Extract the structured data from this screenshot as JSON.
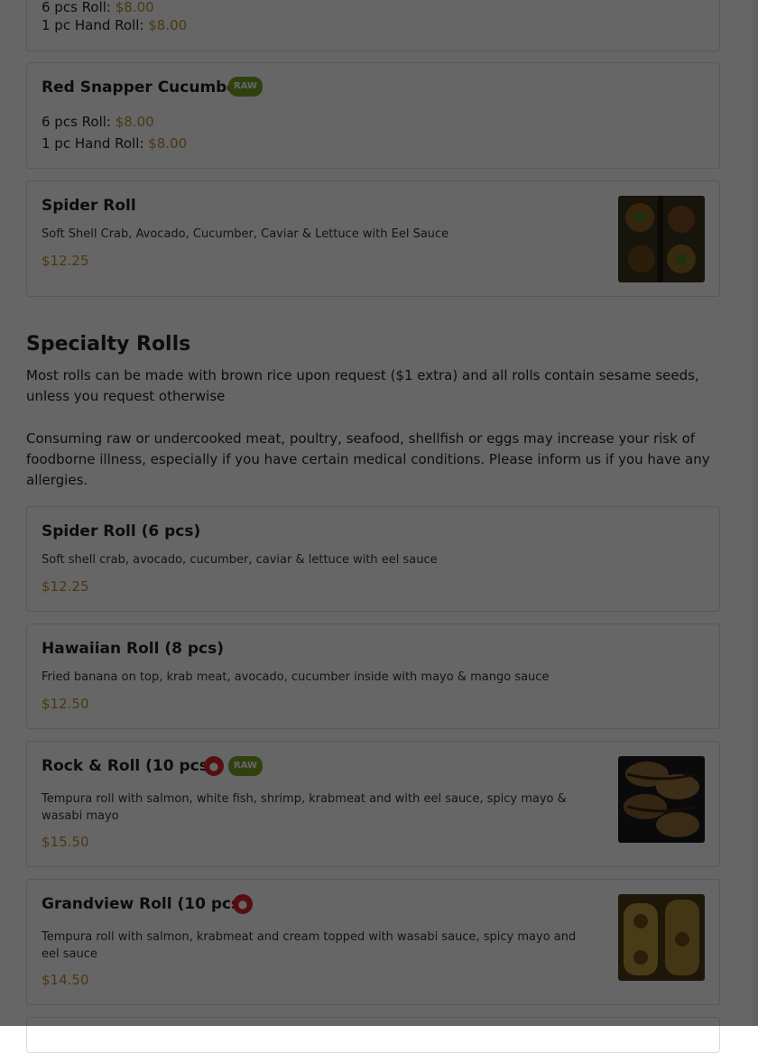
{
  "items_top": [
    {
      "name": "",
      "prices": [
        {
          "label": "6 pcs Roll:",
          "amount": "$8.00"
        },
        {
          "label": "1 pc Hand Roll:",
          "amount": "$8.00"
        }
      ]
    },
    {
      "name": "Red Snapper Cucumber",
      "badge": "RAW",
      "prices": [
        {
          "label": "6 pcs Roll:",
          "amount": "$8.00"
        },
        {
          "label": "1 pc Hand Roll:",
          "amount": "$8.00"
        }
      ]
    },
    {
      "name": "Spider Roll",
      "description": "Soft Shell Crab, Avocado, Cucumber, Caviar & Lettuce with Eel Sauce",
      "price": "$12.25",
      "image": "sushi-photo"
    }
  ],
  "section": {
    "title": "Specialty Rolls",
    "note1": "Most rolls can be made with brown rice upon request ($1 extra) and all rolls contain sesame seeds, unless you request otherwise",
    "note2": "Consuming raw or undercooked meat, poultry, seafood, shellfish or eggs may increase your risk of foodborne illness, especially if you have certain medical conditions. Please inform us if you have any allergies."
  },
  "items": [
    {
      "name": "Spider Roll (6 pcs)",
      "description": "Soft shell crab, avocado, cucumber, caviar & lettuce with eel sauce",
      "price": "$12.25"
    },
    {
      "name": "Hawaiian Roll (8 pcs)",
      "description": "Fried banana on top, krab meat, avocado, cucumber inside with mayo & mango sauce",
      "price": "$12.50"
    },
    {
      "name": "Rock & Roll (10 pcs)",
      "spicy": true,
      "badge": "RAW",
      "description": "Tempura roll with salmon, white fish, shrimp, krabmeat and with eel sauce, spicy mayo & wasabi mayo",
      "price": "$15.50",
      "image": "sushi-photo"
    },
    {
      "name": "Grandview Roll (10 pcs)",
      "spicy": true,
      "description": "Tempura roll with salmon, krabmeat and cream topped with wasabi sauce, spicy mayo and eel sauce",
      "price": "$14.50",
      "image": "sushi-photo"
    }
  ],
  "colors": {
    "price": "#b98a2c",
    "raw_badge": "#79a329",
    "spicy_icon": "#d9232a",
    "overlay": "rgba(0,0,0,0.6)"
  }
}
